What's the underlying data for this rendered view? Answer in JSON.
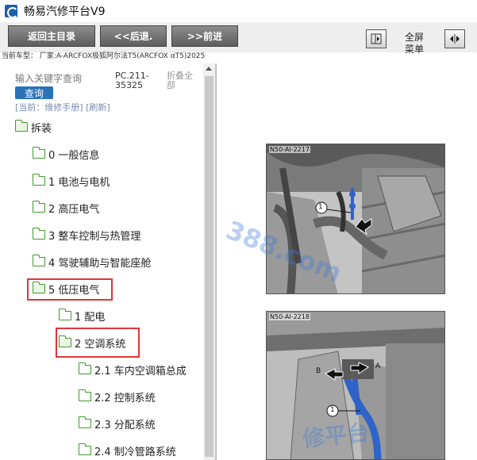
{
  "window": {
    "title": "畅易汽修平台V9"
  },
  "toolbar": {
    "home_label": "返回主目录",
    "back_label": "<<后退.",
    "forward_label": ">>前进",
    "fullscreen_line1": "全屏",
    "fullscreen_line2": "菜单"
  },
  "vehicle": {
    "label": "当前车型：  厂家:A-ARCFOX极狐阿尔法T5(ARCFOX αT5)2025"
  },
  "search": {
    "placeholder": "输入关键字查询",
    "button_label": "查询"
  },
  "doc": {
    "code": "PC.211-35325",
    "collapse_all": "折叠全部"
  },
  "breadcrumb": {
    "text": "[当前：维修手册]  [刷新]"
  },
  "tree": [
    {
      "label": "拆装",
      "level": 0
    },
    {
      "label": "0 一般信息",
      "level": 1
    },
    {
      "label": "1 电池与电机",
      "level": 1
    },
    {
      "label": "2 高压电气",
      "level": 1
    },
    {
      "label": "3 整车控制与热管理",
      "level": 1
    },
    {
      "label": "4 驾驶辅助与智能座舱",
      "level": 1
    },
    {
      "label": "5 低压电气",
      "level": 1,
      "highlighted": true
    },
    {
      "label": "1 配电",
      "level": 2
    },
    {
      "label": "2 空调系统",
      "level": 2,
      "highlighted": true
    },
    {
      "label": "2.1 车内空调箱总成",
      "level": 3
    },
    {
      "label": "2.2 控制系统",
      "level": 3
    },
    {
      "label": "2.3 分配系统",
      "level": 3
    },
    {
      "label": "2.4 制冷管路系统",
      "level": 3
    }
  ],
  "figures": [
    {
      "code": "N50-AI-2217",
      "callout": "1"
    },
    {
      "code": "N50-AI-2218",
      "callout": "1",
      "label_a": "A",
      "label_b": "B"
    }
  ],
  "watermark": {
    "text1": "388.com",
    "text2": "修平台"
  },
  "colors": {
    "highlight": "#e0353b",
    "folder": "#3f9a2f",
    "accent": "#2a73b8",
    "pipe": "#2f63c8"
  }
}
